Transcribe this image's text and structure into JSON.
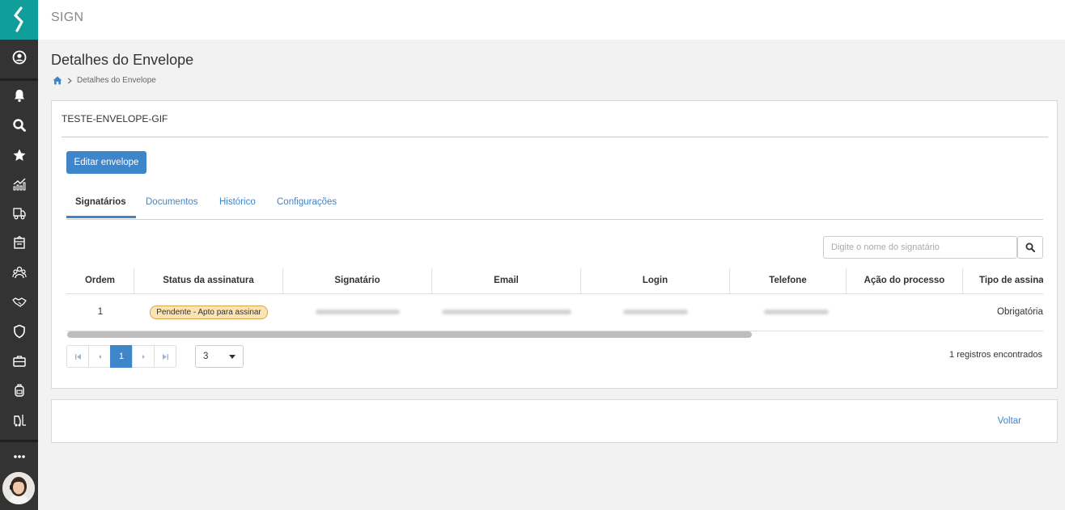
{
  "app": {
    "title": "SIGN"
  },
  "sidebar": {
    "icons": [
      "logo-icon",
      "user-circle-icon",
      "bell-icon",
      "search-icon",
      "star-icon",
      "chart-icon",
      "truck-icon",
      "archive-box-icon",
      "team-icon",
      "handshake-icon",
      "shield-icon",
      "briefcase-icon",
      "backpack-icon",
      "forklift-icon",
      "more-icon"
    ]
  },
  "page": {
    "title": "Detalhes do Envelope",
    "breadcrumb": "Detalhes do Envelope"
  },
  "envelope": {
    "name": "TESTE-ENVELOPE-GIF",
    "edit_label": "Editar envelope"
  },
  "tabs": [
    {
      "label": "Signatários",
      "active": true
    },
    {
      "label": "Documentos"
    },
    {
      "label": "Histórico"
    },
    {
      "label": "Configurações"
    }
  ],
  "search": {
    "placeholder": "Digite o nome do signatário"
  },
  "table": {
    "headers": [
      "Ordem",
      "Status da assinatura",
      "Signatário",
      "Email",
      "Login",
      "Telefone",
      "Ação do processo",
      "Tipo de assina"
    ],
    "rows": [
      {
        "ordem": "1",
        "status": "Pendente - Apto para assinar",
        "acao": "",
        "tipo": "Obrigatória"
      }
    ]
  },
  "pagination": {
    "current_page": "1",
    "page_size": "3",
    "records": "1 registros encontrados"
  },
  "footer": {
    "back_label": "Voltar"
  },
  "colors": {
    "primary": "#3f85c9",
    "brand": "#0f9e99",
    "sidebar": "#333333",
    "badge_bg": "#fce4b0"
  }
}
